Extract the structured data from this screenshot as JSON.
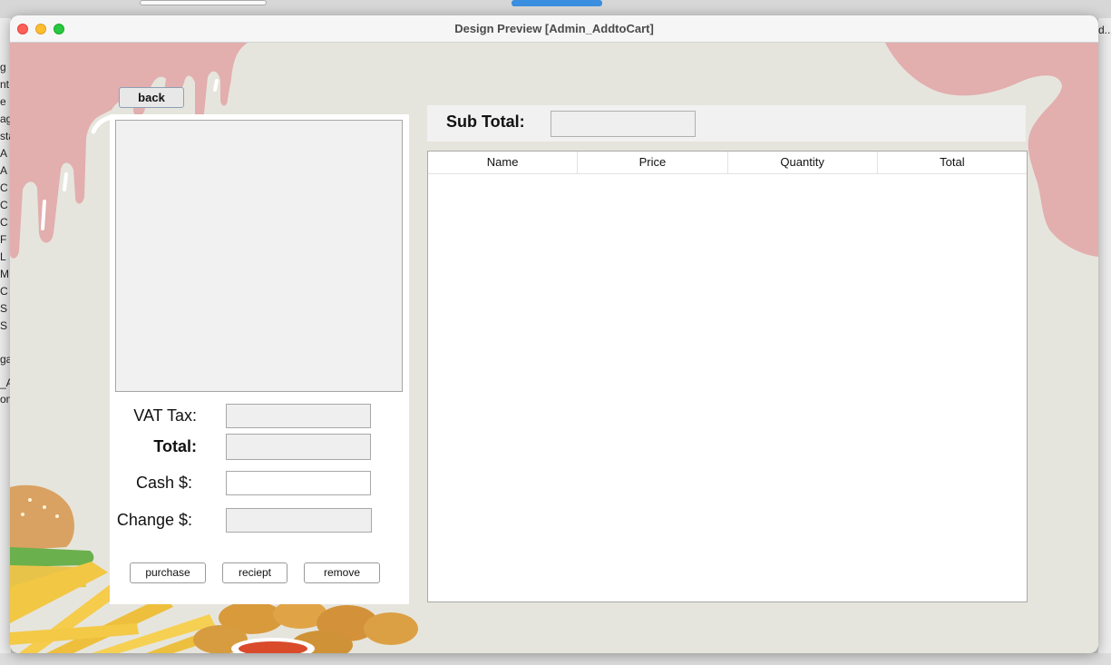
{
  "window": {
    "title": "Design Preview [Admin_AddtoCart]"
  },
  "background": {
    "left_fragments": [
      "g",
      "nt",
      "e",
      "ag",
      "sta",
      "A",
      "A",
      "C",
      "C",
      "C",
      "F",
      "L",
      "M",
      "C",
      "S",
      "S",
      "ga",
      "_A",
      "om"
    ],
    "right_fragment": "d.."
  },
  "actions": {
    "back_label": "back"
  },
  "summary": {
    "vat_label": "VAT Tax:",
    "vat_value": "",
    "total_label": "Total:",
    "total_value": "",
    "cash_label": "Cash $:",
    "cash_value": "",
    "change_label": "Change $:",
    "change_value": ""
  },
  "panel_buttons": {
    "purchase": "purchase",
    "receipt": "reciept",
    "remove": "remove"
  },
  "subtotal": {
    "label": "Sub Total:",
    "value": ""
  },
  "cart_table": {
    "columns": [
      "Name",
      "Price",
      "Quantity",
      "Total"
    ],
    "rows": []
  },
  "colors": {
    "drip_pink": "#e2aeae",
    "window_bg": "#e6e5dd",
    "panel_bg": "#ffffff"
  }
}
